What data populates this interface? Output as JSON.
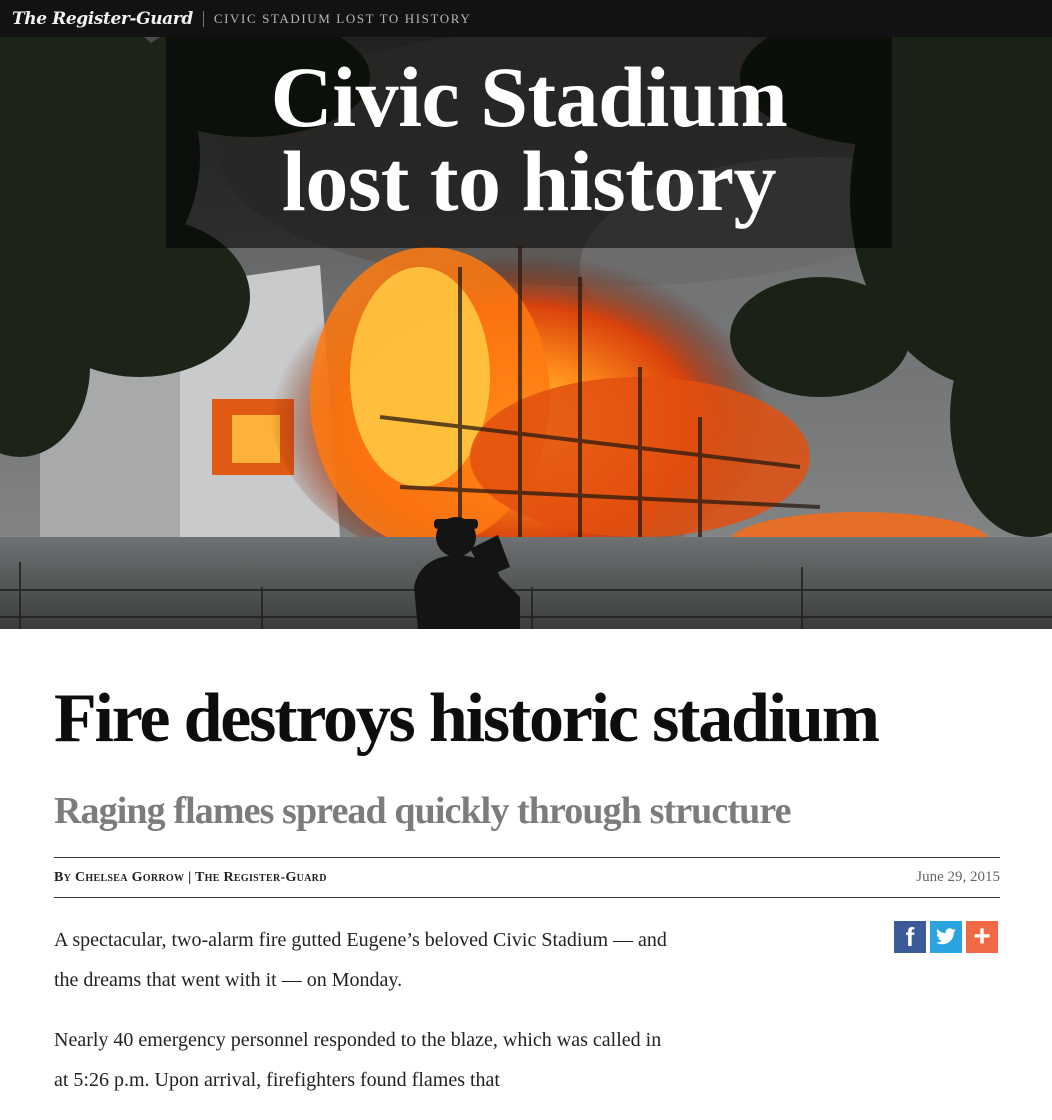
{
  "header": {
    "masthead": "The Register-Guard",
    "section": "CIVIC STADIUM LOST TO HISTORY"
  },
  "hero": {
    "title_line1": "Civic Stadium",
    "title_line2": "lost to history",
    "image": "stadium-fire-photo"
  },
  "article": {
    "headline": "Fire destroys historic stadium",
    "subhead": "Raging flames spread quickly through structure",
    "byline_prefix": "By",
    "author": "Chelsea Gorrow",
    "separator": "|",
    "publication": "The Register-Guard",
    "date": "June 29, 2015",
    "paragraphs": [
      "A spectacular, two-alarm fire gutted Eugene’s beloved Civic Stadium — and the dreams that went with it — on Monday.",
      "Nearly 40 emergency personnel responded to the blaze, which was called in at 5:26 p.m. Upon arrival, firefighters found flames that"
    ]
  },
  "share": {
    "facebook_icon": "f",
    "twitter_icon": "twitter-bird",
    "more_icon": "+"
  },
  "colors": {
    "topbar": "#121212",
    "facebook": "#3b5a9a",
    "twitter": "#2aa3e0",
    "more": "#f26a45"
  }
}
